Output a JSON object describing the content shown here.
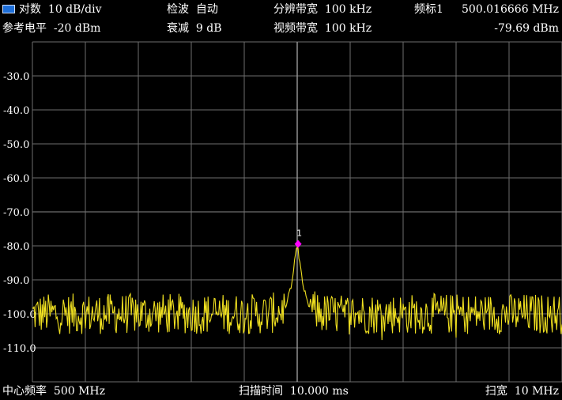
{
  "header": {
    "scale_mode_label": "对数",
    "scale_value": "10 dB/div",
    "detector_label": "检波",
    "detector_value": "自动",
    "rbw_label": "分辨带宽",
    "rbw_value": "100 kHz",
    "marker_label": "频标1",
    "marker_freq": "500.016666 MHz",
    "ref_level_label": "参考电平",
    "ref_level_value": "-20 dBm",
    "atten_label": "衰减",
    "atten_value": "9 dB",
    "vbw_label": "视频带宽",
    "vbw_value": "100 kHz",
    "marker_level": "-79.69 dBm"
  },
  "footer": {
    "center_freq_label": "中心频率",
    "center_freq_value": "500 MHz",
    "sweep_time_label": "扫描时间",
    "sweep_time_value": "10.000 ms",
    "span_label": "扫宽",
    "span_value": "10 MHz"
  },
  "colors": {
    "trace": "#f0e020",
    "marker": "#ff00ff",
    "grid": "#6e6e6e",
    "background": "#000000",
    "log_icon": "#1e6fd9"
  },
  "icons": {
    "scale_mode": "log-scale-icon",
    "marker": "marker-diamond-icon"
  },
  "chart_data": {
    "type": "line",
    "y_unit": "dBm",
    "x_unit": "MHz",
    "ylim": [
      -120,
      -20
    ],
    "xlim": [
      495,
      505
    ],
    "y_ticks": [
      "-30.0",
      "-40.0",
      "-50.0",
      "-60.0",
      "-70.0",
      "-80.0",
      "-90.0",
      "-100.0",
      "-110.0"
    ],
    "grid": true,
    "noise_floor_dbm": -100,
    "noise_spread_db": 6,
    "series": [
      {
        "x": [
          495,
          499.5,
          499.7,
          499.8,
          499.9,
          499.95,
          500.0,
          500.05,
          500.1,
          500.2,
          500.3,
          500.5,
          505
        ],
        "values": [
          -100,
          -100,
          -99,
          -97,
          -91,
          -85,
          -79.7,
          -85,
          -91,
          -97,
          -99,
          -100,
          -100
        ]
      }
    ],
    "marker": {
      "label": "1",
      "x": 500.016666,
      "y": -79.69
    }
  }
}
